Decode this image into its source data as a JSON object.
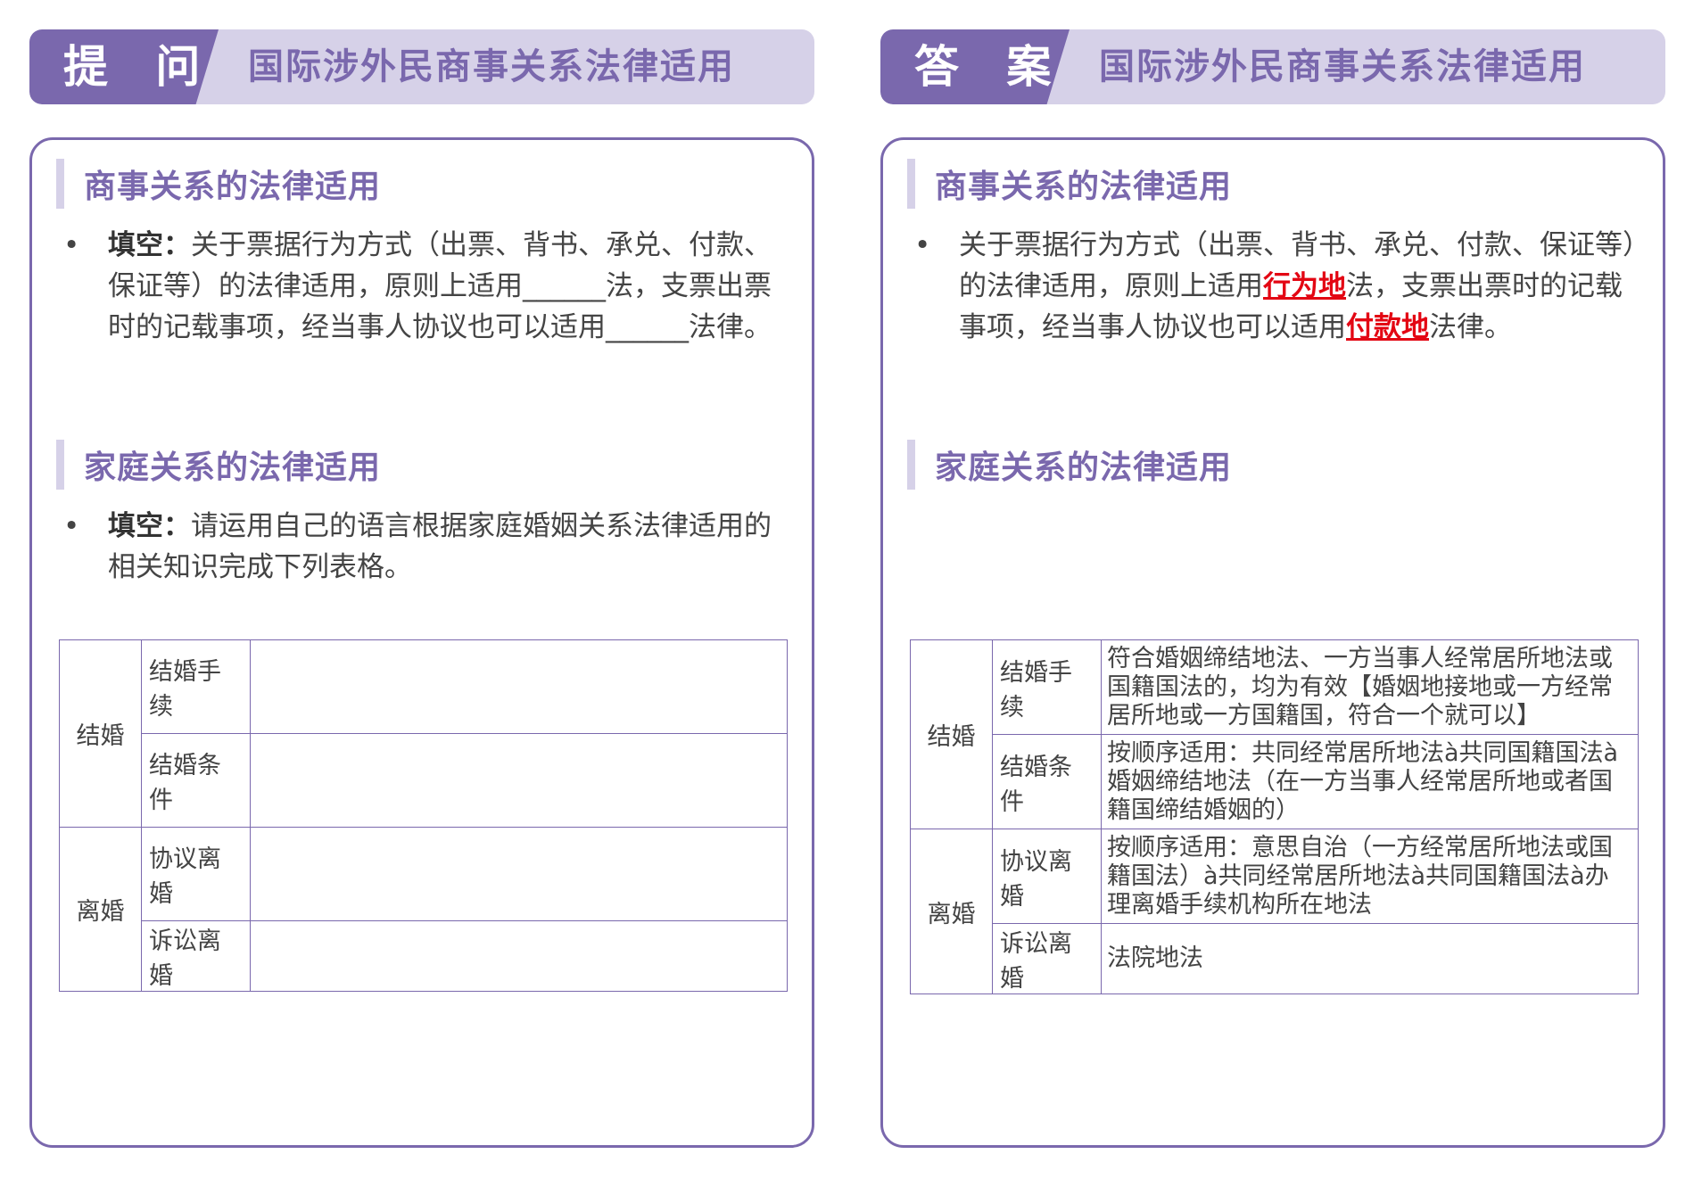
{
  "left": {
    "tag": "提 问",
    "title": "国际涉外民商事关系法律适用",
    "section1": {
      "heading": "商事关系的法律适用",
      "bullet": "•",
      "label": "填空：",
      "text": "关于票据行为方式（出票、背书、承兑、付款、保证等）的法律适用，原则上适用______法，支票出票时的记载事项，经当事人协议也可以适用______法律。"
    },
    "section2": {
      "heading": "家庭关系的法律适用",
      "bullet": "•",
      "label": "填空：",
      "text": "请运用自己的语言根据家庭婚姻关系法律适用的相关知识完成下列表格。"
    },
    "table": {
      "marriage": "结婚",
      "divorce": "离婚",
      "rows": [
        "结婚手续",
        "结婚条件",
        "协议离婚",
        "诉讼离婚"
      ]
    }
  },
  "right": {
    "tag": "答 案",
    "title": "国际涉外民商事关系法律适用",
    "section1": {
      "heading": "商事关系的法律适用",
      "bullet": "•",
      "text_a": "关于票据行为方式（出票、背书、承兑、付款、保证等）的法律适用，原则上适用",
      "answer1": "行为地",
      "text_b": "法，支票出票时的记载事项，经当事人协议也可以适用",
      "answer2": "付款地",
      "text_c": "法律。"
    },
    "section2": {
      "heading": "家庭关系的法律适用"
    },
    "table": {
      "marriage": "结婚",
      "divorce": "离婚",
      "rows": [
        "结婚手续",
        "结婚条件",
        "协议离婚",
        "诉讼离婚"
      ],
      "answers": [
        "符合婚姻缔结地法、一方当事人经常居所地法或国籍国法的，均为有效【婚姻地接地或一方经常居所地或一方国籍国，符合一个就可以】",
        "按顺序适用：共同经常居所地法à共同国籍国法à婚姻缔结地法（在一方当事人经常居所地或者国籍国缔结婚姻的）",
        "按顺序适用：意思自治（一方经常居所地法或国籍国法）à共同经常居所地法à共同国籍国法à办理离婚手续机构所在地法",
        "法院地法"
      ]
    }
  },
  "colors": {
    "purple": "#7a68ad",
    "lavender": "#d6d1e8",
    "answer_red": "#e30613"
  }
}
